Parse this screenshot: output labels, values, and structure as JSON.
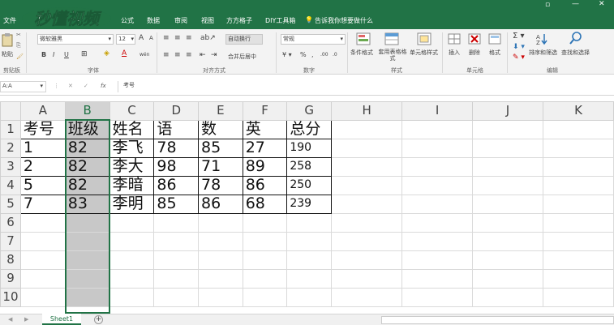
{
  "ribbon_tabs": [
    "文件",
    "开始",
    "插入",
    "公式",
    "数据",
    "审阅",
    "视图",
    "方方格子",
    "DIY工具箱"
  ],
  "tell_me": "告诉我你想要做什么",
  "watermark": "秒懂视频",
  "clipboard": {
    "paste": "粘贴",
    "label": "剪贴板"
  },
  "font": {
    "name": "微软雅黑",
    "size": "12",
    "grow": "A",
    "shrink": "A",
    "bold": "B",
    "italic": "I",
    "underline": "U",
    "font_color": "A",
    "label": "字体",
    "wen": "wén"
  },
  "alignment": {
    "wrap": "自动换行",
    "merge": "合并后居中",
    "label": "对齐方式"
  },
  "number": {
    "format": "常规",
    "percent": "%",
    "comma": ",",
    "label": "数字"
  },
  "styles": {
    "conditional": "条件格式",
    "table_format": "套用表格格式",
    "cell_styles": "单元格样式",
    "label": "样式"
  },
  "cells": {
    "insert": "插入",
    "delete": "删除",
    "format": "格式",
    "label": "单元格"
  },
  "editing": {
    "sort": "排序和筛选",
    "find": "查找和选择",
    "label": "编辑"
  },
  "name_box": "A:A",
  "formula_value": "考号",
  "fx": "fx",
  "columns": [
    "A",
    "B",
    "C",
    "D",
    "E",
    "F",
    "G",
    "H",
    "I",
    "J",
    "K"
  ],
  "rows": [
    [
      "考号",
      "班级",
      "姓名",
      "语",
      "数",
      "英",
      "总分"
    ],
    [
      "1",
      "82",
      "李飞",
      "78",
      "85",
      "27",
      "190"
    ],
    [
      "2",
      "82",
      "李大",
      "98",
      "71",
      "89",
      "258"
    ],
    [
      "5",
      "82",
      "李暗",
      "86",
      "78",
      "86",
      "250"
    ],
    [
      "7",
      "83",
      "李明",
      "85",
      "86",
      "68",
      "239"
    ],
    [
      "",
      "",
      "",
      "",
      "",
      "",
      ""
    ],
    [
      "",
      "",
      "",
      "",
      "",
      "",
      ""
    ],
    [
      "",
      "",
      "",
      "",
      "",
      "",
      ""
    ],
    [
      "",
      "",
      "",
      "",
      "",
      "",
      ""
    ],
    [
      "",
      "",
      "",
      "",
      "",
      "",
      ""
    ]
  ],
  "sheet_tab": "Sheet1",
  "add_sheet": "+",
  "colors": {
    "accent": "#217346",
    "selected_column": "#c8c8c8"
  }
}
